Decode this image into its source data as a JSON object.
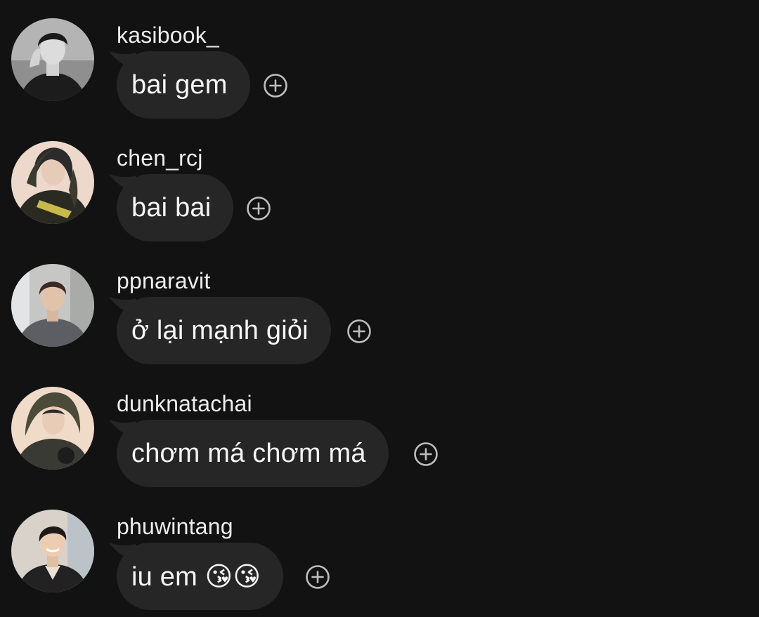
{
  "messages": [
    {
      "username": "kasibook_",
      "text": "bai gem",
      "avatar_icon": "user-photo-bw-icon",
      "avatar_bg": "#9a9a9a"
    },
    {
      "username": "chen_rcj",
      "text": "bai bai",
      "avatar_icon": "user-photo-icon",
      "avatar_bg": "#e9d6c8"
    },
    {
      "username": "ppnaravit",
      "text": "ở lại mạnh giỏi",
      "avatar_icon": "user-photo-icon",
      "avatar_bg": "#c9c9c7"
    },
    {
      "username": "dunknatachai",
      "text": "chơm má chơm má",
      "avatar_icon": "user-photo-icon",
      "avatar_bg": "#efd9c6"
    },
    {
      "username": "phuwintang",
      "text": "iu em 😘😘",
      "avatar_icon": "user-photo-icon",
      "avatar_bg": "#d9d3cc"
    }
  ],
  "react_icon": "add-reaction-icon",
  "colors": {
    "background": "#121212",
    "bubble": "#262626",
    "text": "#f5f5f5",
    "icon": "#bdbdbd"
  }
}
